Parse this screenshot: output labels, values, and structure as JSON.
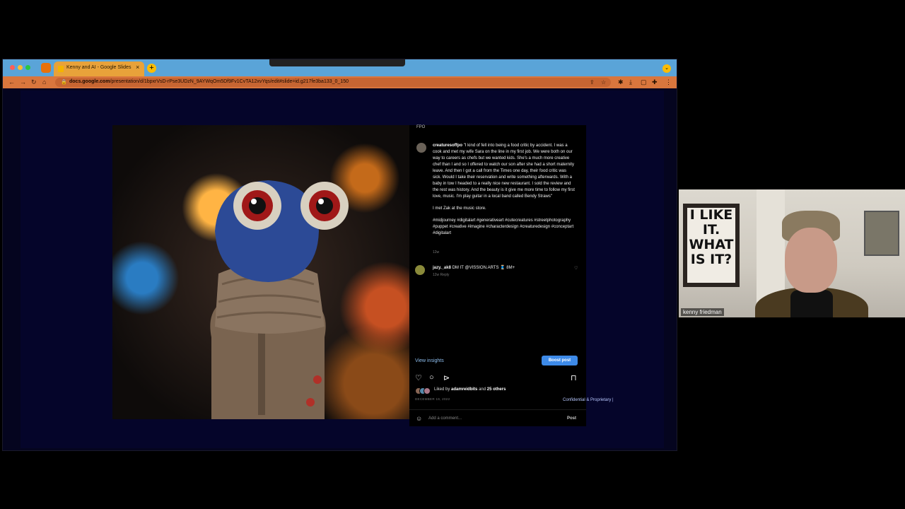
{
  "browser": {
    "tab_title": "Kenny and AI - Google Slides",
    "tab_close": "×",
    "new_tab": "+",
    "url": {
      "host": "docs.google.com",
      "path": "/presentation/d/1bpxrVsD-rPse3UDzN_9AYWqOm5Df9Fv1CvTA12xvYqs/edit#slide=id.g217fe3ba133_0_150"
    }
  },
  "instagram": {
    "top_user": "FPO",
    "caption": {
      "username": "creaturesoffpo",
      "text": "\"I kind of fell into being a food critic by accident. I was a cook and met my wife Sara on the line in my first job. We were both on our way to careers as chefs but we wanted kids. She's a much more creative chef than I and so I offered to watch our son after she had a short maternity leave. And then I got a call from the Times one day, their food critic was sick. Would I take their reservation and write something afterwards. With a baby in tow I headed to a really nice new restaurant. I sold the review and the rest was history. And the beauty is it give me more time to follow my first love, music. I'm play guitar in a local band called Bendy Straws\"",
      "line2": "I met Zak at the music store.",
      "hashtags": "#midjourney #digitalart #generativeart #cutecreatures #streetphotography #puppet #creative #imagine #characterdesign #creaturedesign #conceptart #digitalart",
      "time": "12w"
    },
    "comment": {
      "username": "jazy._ak8",
      "text": "DM IT @VISSION.ARTS 🧵 8M+",
      "meta": "12w   Reply"
    },
    "view_insights": "View insights",
    "boost_post": "Boost post",
    "likes": {
      "prefix": "Liked by",
      "user": "adamreidbits",
      "and": "and",
      "others": "25 others"
    },
    "date": "DECEMBER 19, 2022",
    "comment_placeholder": "Add a comment...",
    "post_label": "Post"
  },
  "slide_footer": "Confidential & Proprietary  |",
  "video_tile": {
    "name": "kenny friedman",
    "poster_text": [
      "I LIKE",
      "IT.",
      "WHAT",
      "IS IT?"
    ]
  },
  "colors": {
    "tabstrip": "#5aa4d8",
    "toolbar": "#d9763d",
    "slide_bg": "#05052a",
    "boost_button": "#3d8ae8"
  }
}
